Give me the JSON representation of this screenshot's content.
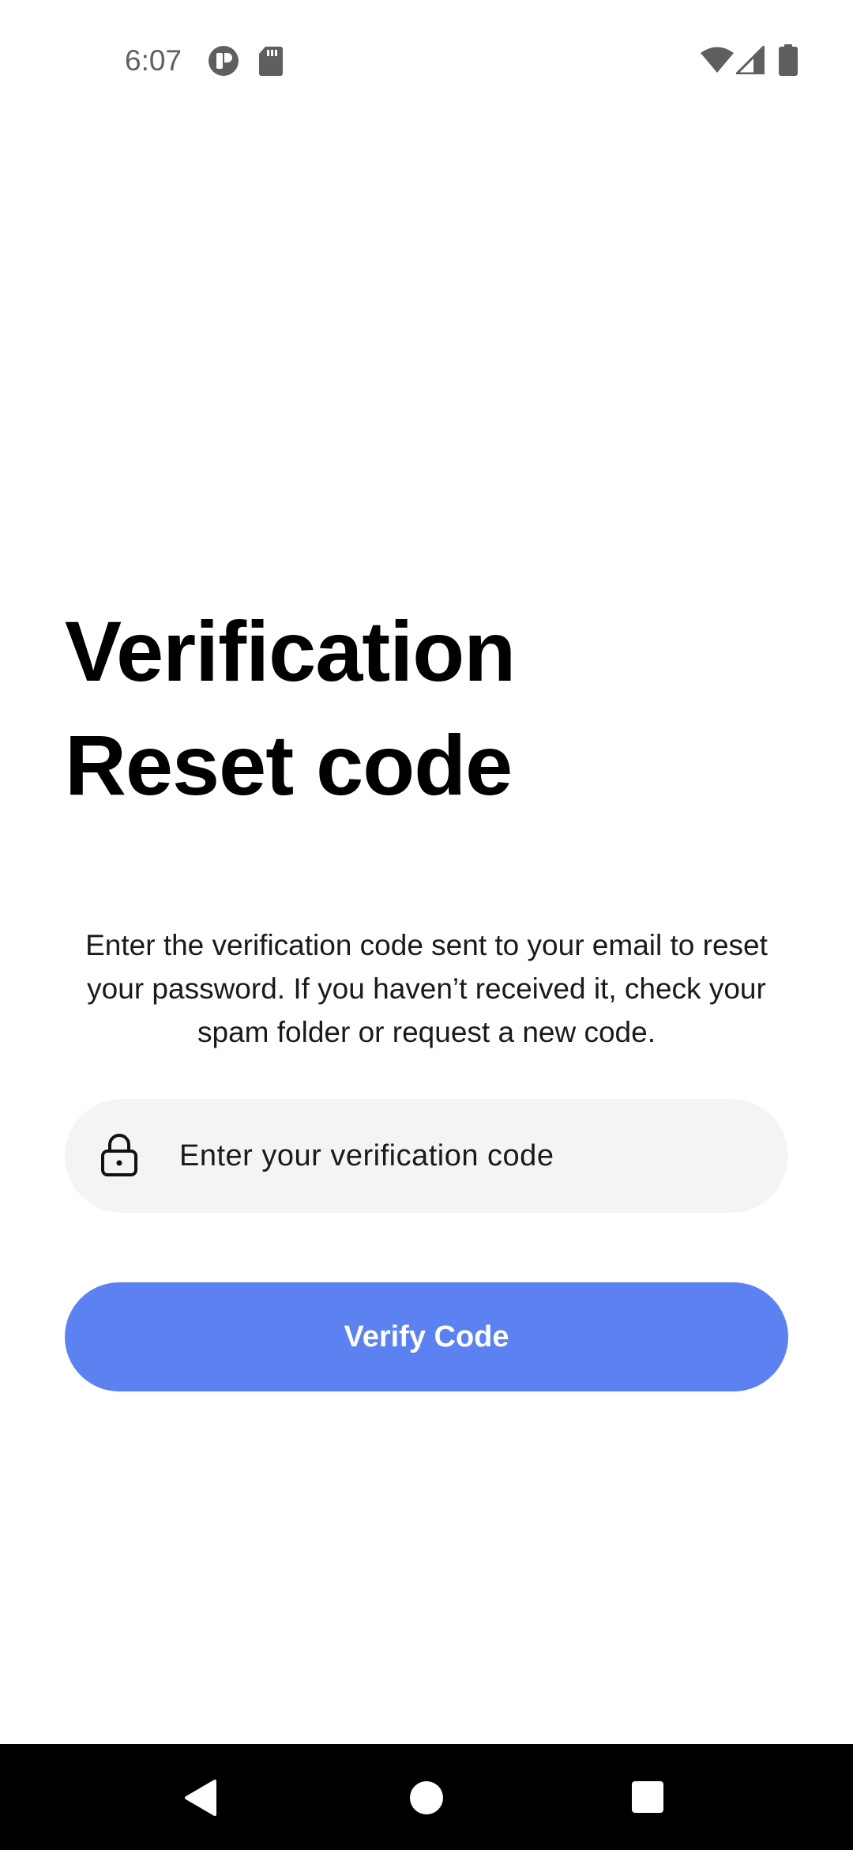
{
  "status_bar": {
    "time": "6:07",
    "icons": [
      "app-notification-icon",
      "sd-card-icon",
      "wifi-icon",
      "cell-signal-icon",
      "battery-icon"
    ]
  },
  "title": {
    "line1": "Verification",
    "line2": "Reset code"
  },
  "description": "Enter the verification code sent to your email to reset your password. If you haven’t received it, check your spam folder or request a new code.",
  "code_field": {
    "icon": "lock-icon",
    "placeholder": "Enter your verification code",
    "value": ""
  },
  "verify_button": {
    "label": "Verify Code",
    "color": "#5b82f0"
  },
  "nav_bar": {
    "items": [
      "back-icon",
      "home-icon",
      "recents-icon"
    ]
  }
}
